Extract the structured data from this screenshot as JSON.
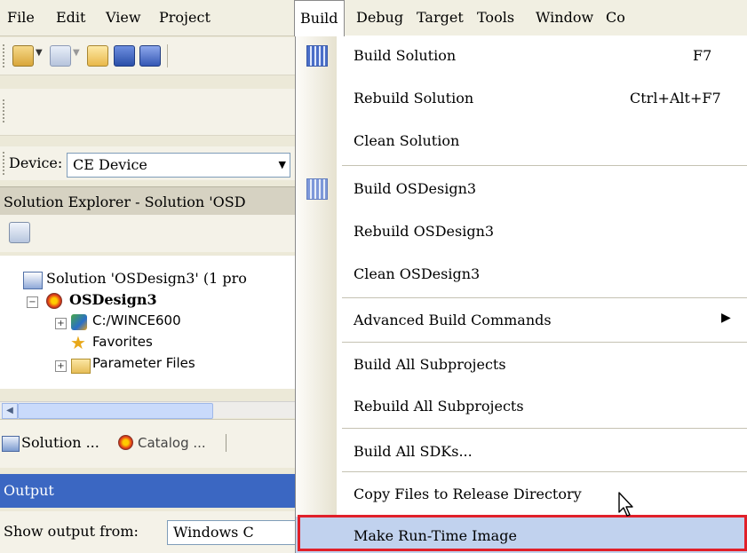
{
  "menubar": {
    "items": [
      "File",
      "Edit",
      "View",
      "Project",
      "Build",
      "Debug",
      "Target",
      "Tools",
      "Window",
      "Co"
    ],
    "active": "Build"
  },
  "device": {
    "label": "Device:",
    "value": "CE Device"
  },
  "solution_explorer": {
    "title": "Solution Explorer - Solution 'OSD",
    "tree": [
      "Solution 'OSDesign3' (1 pro",
      "OSDesign3",
      "C:/WINCE600",
      "Favorites",
      "Parameter Files"
    ]
  },
  "tabs": [
    "Solution ...",
    "Catalog ..."
  ],
  "output": {
    "title": "Output",
    "show_label": "Show output from:",
    "source": "Windows C"
  },
  "build_menu": {
    "items": [
      {
        "label": "Build Solution",
        "accel": "F7"
      },
      {
        "label": "Rebuild Solution",
        "accel": "Ctrl+Alt+F7"
      },
      {
        "label": "Clean Solution",
        "accel": ""
      },
      {
        "label": "Build OSDesign3",
        "accel": ""
      },
      {
        "label": "Rebuild OSDesign3",
        "accel": ""
      },
      {
        "label": "Clean OSDesign3",
        "accel": ""
      },
      {
        "label": "Advanced Build Commands",
        "accel": ""
      },
      {
        "label": "Build All Subprojects",
        "accel": ""
      },
      {
        "label": "Rebuild All Subprojects",
        "accel": ""
      },
      {
        "label": "Build All SDKs...",
        "accel": ""
      },
      {
        "label": "Copy Files to Release Directory",
        "accel": ""
      },
      {
        "label": "Make Run-Time Image",
        "accel": ""
      }
    ],
    "highlighted": "Make Run-Time Image"
  },
  "colors": {
    "highlight": "#c1d2ee",
    "callout_border": "#e0202a",
    "output_title": "#3b67c2"
  }
}
